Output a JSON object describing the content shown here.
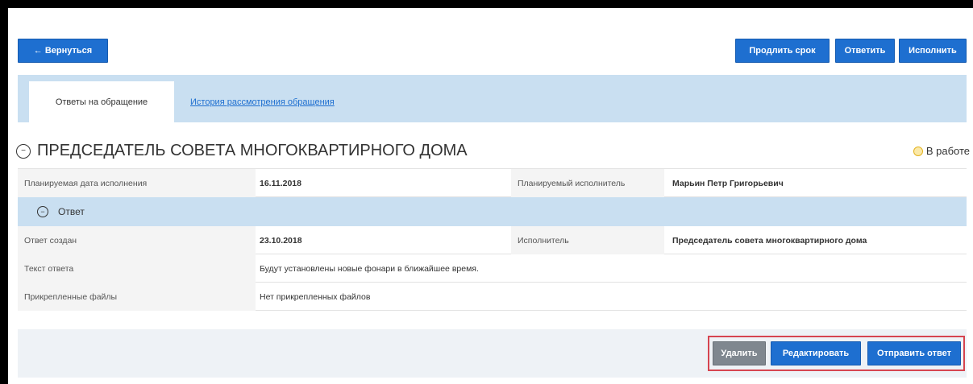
{
  "toolbar": {
    "back_label": "← Вернуться",
    "extend_label": "Продлить срок",
    "reply_label": "Ответить",
    "execute_label": "Исполнить"
  },
  "tabs": [
    {
      "label": "Ответы на обращение",
      "active": true
    },
    {
      "label": "История рассмотрения обращения",
      "active": false
    }
  ],
  "section": {
    "title": "ПРЕДСЕДАТЕЛЬ СОВЕТА МНОГОКВАРТИРНОГО ДОМА",
    "status": "В работе"
  },
  "plan": {
    "date_label": "Планируемая дата исполнения",
    "date_value": "16.11.2018",
    "executor_label": "Планируемый исполнитель",
    "executor_value": "Марьин Петр Григорьевич"
  },
  "answer": {
    "header": "Ответ",
    "created_label": "Ответ создан",
    "created_value": "23.10.2018",
    "executor_label": "Исполнитель",
    "executor_value": "Председатель совета многоквартирного дома",
    "text_label": "Текст ответа",
    "text_value": "Будут установлены новые фонари в ближайшее время.",
    "files_label": "Прикрепленные файлы",
    "files_value": "Нет прикрепленных файлов"
  },
  "actions": {
    "delete_label": "Удалить",
    "edit_label": "Редактировать",
    "send_label": "Отправить ответ"
  },
  "colors": {
    "primary": "#1e6fd0",
    "secondary": "#7f878f",
    "panel": "#c9dff1",
    "highlight_border": "#d64550"
  },
  "icons": {
    "collapse": "minus-circle-icon",
    "status": "clock-icon"
  }
}
